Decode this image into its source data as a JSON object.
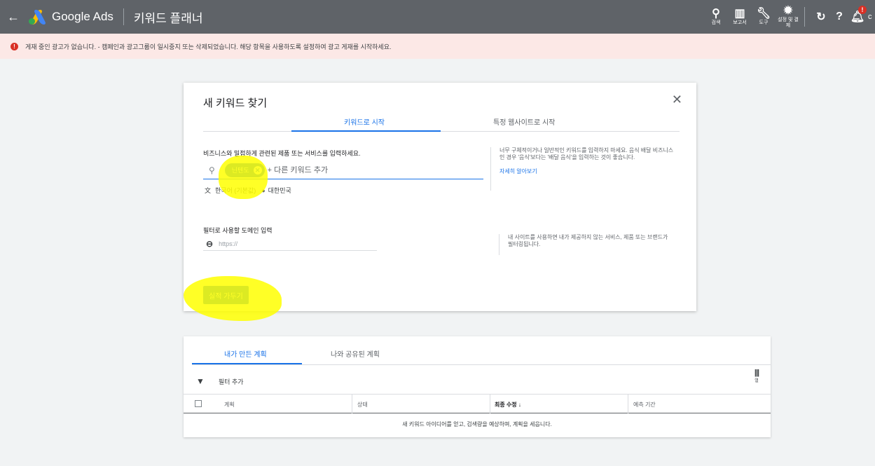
{
  "header": {
    "back_icon": "arrow-left-icon",
    "brand": "Google Ads",
    "page_title": "키워드 플래너",
    "tools": [
      {
        "icon": "search-icon",
        "glyph": "Q",
        "label": "검색"
      },
      {
        "icon": "reports-icon",
        "glyph": "▥",
        "label": "보고서"
      },
      {
        "icon": "wrench-icon",
        "glyph": "✎",
        "label": "도구"
      },
      {
        "icon": "gear-icon",
        "glyph": "✹",
        "label": "설정 및 결제"
      }
    ],
    "refresh_icon": "refresh-icon",
    "help_icon": "help-icon",
    "notification_badge": "!",
    "user_initial": "c"
  },
  "alert": {
    "icon": "error-icon",
    "message": "게재 중인 광고가 없습니다. - 캠페인과 광고그룹이 일시중지 또는 삭제되었습니다. 해당 항목을 사용하도록 설정하여 광고 게재를 시작하세요."
  },
  "dialog": {
    "title": "새 키워드 찾기",
    "close_icon": "close-icon",
    "tabs": [
      {
        "label": "키워드로 시작",
        "active": true
      },
      {
        "label": "특정 웹사이트로 시작",
        "active": false
      }
    ],
    "keyword_section": {
      "label": "비즈니스와 밀접하게 관련된 제품 또는 서비스를 입력하세요.",
      "chip": "닌텐도",
      "placeholder": "+ 다른 키워드 추가",
      "language": "한국어 (기본값)",
      "location": "대한민국",
      "help_text": "너무 구체적이거나 일반적인 키워드를 입력하지 마세요. 음식 배달 비즈니스인 경우 '음식'보다는 '배달 음식'을 입력하는 것이 좋습니다.",
      "help_link": "자세히 알아보기"
    },
    "domain_section": {
      "label": "필터로 사용할 도메인 입력",
      "placeholder": "https://",
      "help_text": "내 사이트를 사용하면 내가 제공하지 않는 서비스, 제품 또는 브랜드가 필터링됩니다."
    },
    "submit_label": "실적 가두기"
  },
  "highlight_color": "#ffff00",
  "accent_color": "#1a73e8",
  "plans": {
    "tabs": [
      {
        "label": "내가 만든 계획",
        "active": true
      },
      {
        "label": "나와 공유된 계획",
        "active": false
      }
    ],
    "filter_label": "필터 추가",
    "columns_label": "열",
    "columns": {
      "plan": "계획",
      "status": "상태",
      "modified": "최종 수정 ↓",
      "forecast": "예측 기간"
    },
    "empty_message": "새 키워드 아이디어를 얻고, 검색량을 예상하며, 계획을 세웁니다."
  }
}
